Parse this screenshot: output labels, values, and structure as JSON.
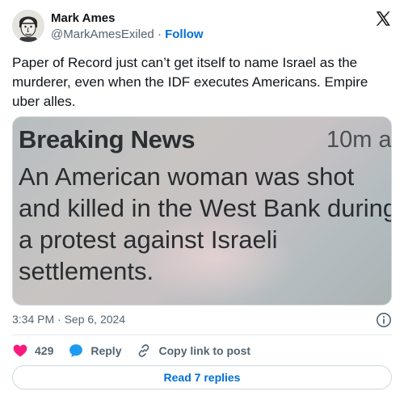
{
  "author": {
    "display_name": "Mark Ames",
    "handle": "@MarkAmesExiled",
    "separator": "·",
    "follow_label": "Follow"
  },
  "tweet": {
    "text": "Paper of Record just can’t get itself to name Israel as the murderer, even when the IDF executes Americans. Empire uber alles.",
    "timestamp": "3:34 PM · Sep 6, 2024"
  },
  "media": {
    "headline": "Breaking News",
    "time_ago": "10m a",
    "body": "An American woman was shot and killed in the West Bank during a protest against Israeli settlements."
  },
  "actions": {
    "like_count": "429",
    "reply_label": "Reply",
    "copy_label": "Copy link to post"
  },
  "replies": {
    "label": "Read 7 replies"
  },
  "icons": {
    "logo": "x-logo-icon",
    "info": "info-icon",
    "like": "heart-icon",
    "reply": "speech-bubble-icon",
    "copy": "link-icon"
  },
  "colors": {
    "like": "#f91880",
    "reply": "#1d9bf0",
    "link": "#006fd6",
    "muted": "#536471"
  }
}
